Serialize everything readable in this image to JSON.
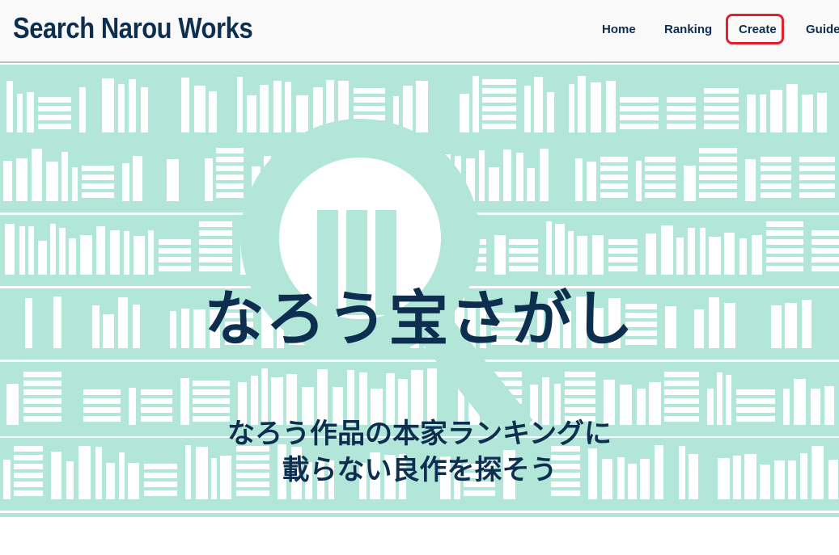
{
  "header": {
    "brand": "Search Narou Works",
    "nav": {
      "home": "Home",
      "ranking": "Ranking",
      "create": "Create",
      "guide": "Guide"
    }
  },
  "hero": {
    "title": "なろう宝さがし",
    "subtitle_line1": "なろう作品の本家ランキングに",
    "subtitle_line2": "載らない良作を探そう",
    "illustration": "bookshelf-magnifier-illustration"
  },
  "colors": {
    "navy": "#0e2e4f",
    "mint": "#b1e6d8",
    "highlight": "#e0202a",
    "header_bg": "#f9f9f9"
  }
}
